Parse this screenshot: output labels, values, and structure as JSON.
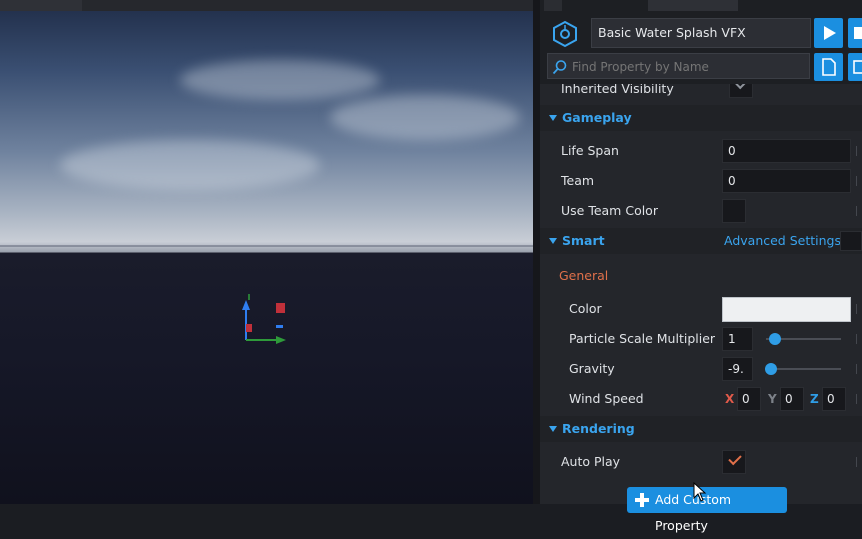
{
  "viewport": {
    "label": "3D viewport"
  },
  "header": {
    "object_name": "Basic Water Splash VFX",
    "search_placeholder": "Find Property by Name",
    "play_icon": "play-icon",
    "stop_icon": "stop-icon",
    "document_icon": "document-icon",
    "logo_icon": "template-icon"
  },
  "properties": {
    "inherited_visibility": {
      "label": "Inherited Visibility",
      "checked": true
    },
    "gameplay": {
      "title": "Gameplay",
      "life_span": {
        "label": "Life Span",
        "value": "0"
      },
      "team": {
        "label": "Team",
        "value": "0"
      },
      "use_team_color": {
        "label": "Use Team Color",
        "checked": false
      }
    },
    "smart": {
      "title": "Smart",
      "advanced_settings": "Advanced Settings",
      "general": "General",
      "color": {
        "label": "Color",
        "value": "#eef0f2"
      },
      "particle_scale": {
        "label": "Particle Scale Multiplier",
        "value": "1",
        "slider": 0.12
      },
      "gravity": {
        "label": "Gravity",
        "value": "-9.",
        "slider": 0.06
      },
      "wind_speed": {
        "label": "Wind Speed",
        "x_label": "X",
        "x": "0",
        "y_label": "Y",
        "y": "0",
        "z_label": "Z",
        "z": "0"
      }
    },
    "rendering": {
      "title": "Rendering",
      "auto_play": {
        "label": "Auto Play",
        "checked": true
      }
    }
  },
  "add_custom_property": "Add Custom Property",
  "colors": {
    "accent": "#1b8fe0",
    "section_title": "#3aa4ee",
    "general_label": "#e0704a",
    "x_axis": "#e05a4a",
    "y_axis": "#7d8289",
    "z_axis": "#2f9de6",
    "tick_orange": "#e0704a"
  }
}
